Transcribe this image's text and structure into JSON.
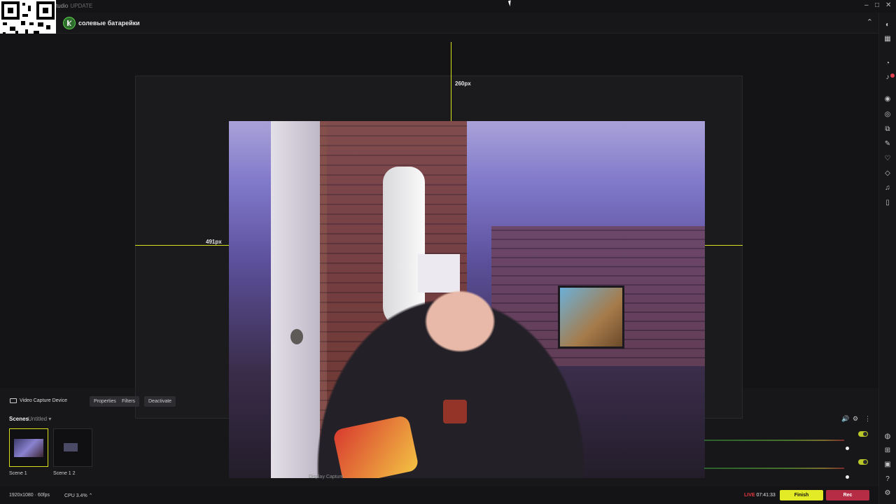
{
  "app": {
    "title_text": "tudio",
    "update_badge": "UPDATE"
  },
  "header": {
    "account_name": "солевые батарейки"
  },
  "canvas": {
    "width_label": "260px",
    "height_label": "491px"
  },
  "source": {
    "name": "Video Capture Device",
    "buttons": {
      "properties": "Properties",
      "filters": "Filters",
      "deactivate": "Deactivate"
    },
    "hidden_label": "Display Capture"
  },
  "scenes": {
    "header": "Scenes",
    "collection": "Untitled",
    "items": [
      {
        "label": "Scene 1"
      },
      {
        "label": "Scene 1 2"
      }
    ]
  },
  "status": {
    "resolution": "1920x1080 · 60fps",
    "cpu": "CPU 3.4%",
    "live_label": "LIVE",
    "live_time": "07:41:33"
  },
  "controls": {
    "finish_label": "Finish",
    "rec_label": "Rec"
  },
  "colors": {
    "accent": "#e3ea26",
    "rec": "#b62c44",
    "live": "#e8383d"
  },
  "icons": [
    "qr-code-icon",
    "minimize-icon",
    "maximize-icon",
    "close-icon",
    "chevron-up-icon",
    "camera-icon",
    "settings-icon",
    "speaker-icon",
    "menu-icon",
    "help-icon"
  ]
}
